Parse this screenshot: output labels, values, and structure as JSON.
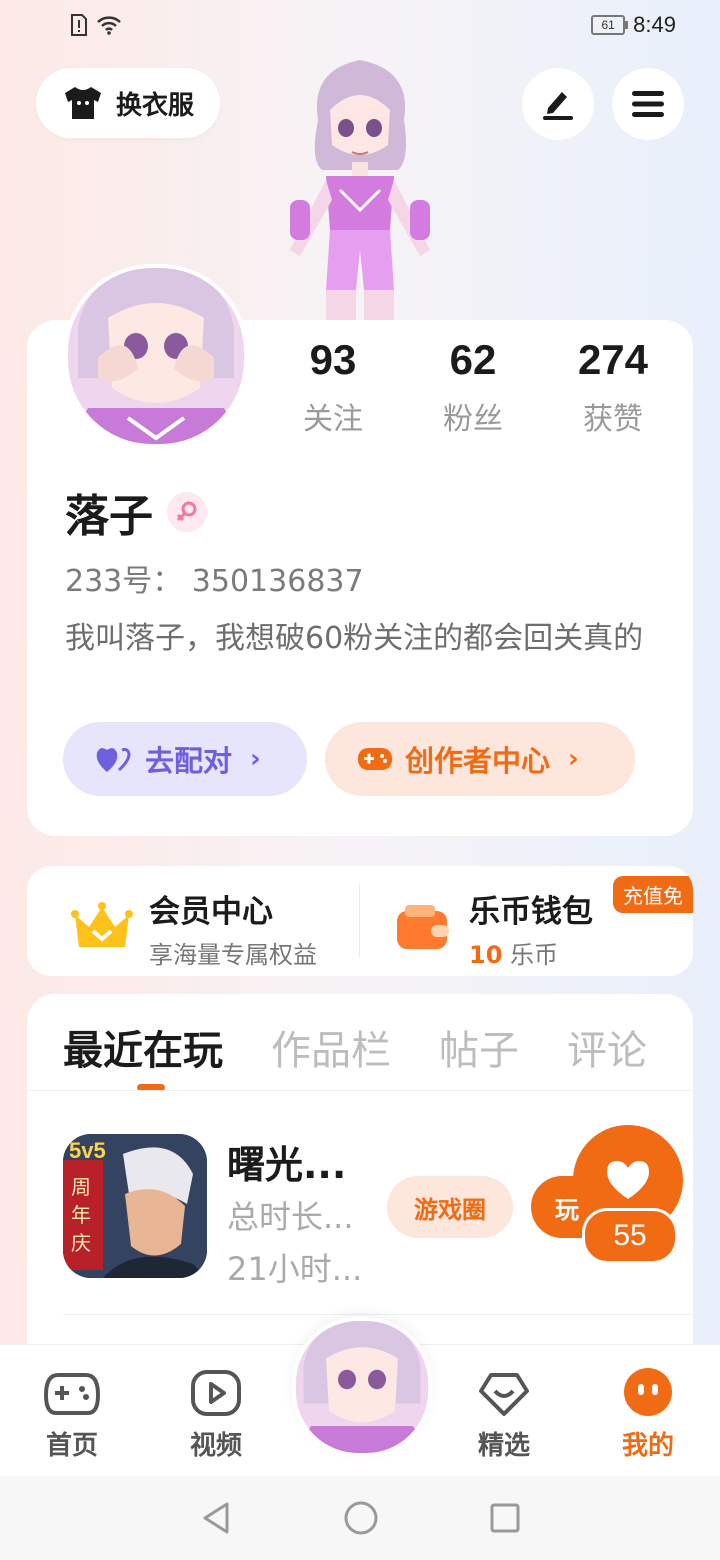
{
  "status_bar": {
    "battery": "61",
    "time": "8:49"
  },
  "header": {
    "outfit_label": "换衣服",
    "edit_icon": "pencil-icon",
    "menu_icon": "hamburger-menu-icon"
  },
  "profile": {
    "stats": [
      {
        "value": "93",
        "label": "关注"
      },
      {
        "value": "62",
        "label": "粉丝"
      },
      {
        "value": "274",
        "label": "获赞"
      }
    ],
    "nickname": "落子",
    "gender": "female",
    "account_id": "233号： 350136837",
    "bio": "我叫落子，我想破60粉关注的都会回关真的",
    "match_label": "去配对",
    "creator_label": "创作者中心"
  },
  "vip": {
    "member_title": "会员中心",
    "member_sub": "享海量专属权益",
    "wallet_title": "乐币钱包",
    "coin_value": "10",
    "coin_unit": "乐币",
    "recharge_tag": "充值免"
  },
  "tabs": [
    "最近在玩",
    "作品栏",
    "帖子",
    "评论"
  ],
  "game": {
    "icon_text_top": "5v5",
    "icon_text_side": "周年庆",
    "name": "曙光...",
    "meta1": "总时长...",
    "meta2": "21小时...",
    "circle_btn": "游戏圈",
    "play_btn": "玩"
  },
  "like": {
    "count": "55"
  },
  "bottom_nav": [
    {
      "label": "首页",
      "icon": "gamepad-icon"
    },
    {
      "label": "视频",
      "icon": "video-play-icon"
    },
    {
      "label": "精选",
      "icon": "heart-diamond-icon"
    },
    {
      "label": "我的",
      "icon": "me-face-icon"
    }
  ],
  "colors": {
    "accent": "#f16a14",
    "match": "#6c5fe0"
  }
}
